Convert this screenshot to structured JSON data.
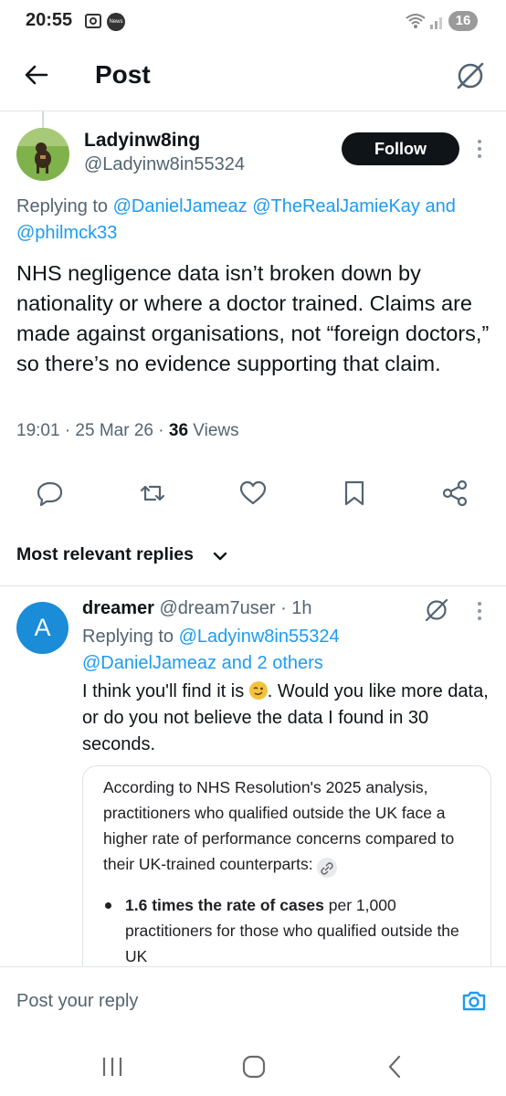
{
  "status_bar": {
    "time": "20:55",
    "battery": "16",
    "news_label": "News"
  },
  "header": {
    "title": "Post"
  },
  "post": {
    "author_name": "Ladyinw8ing",
    "author_handle": "@Ladyinw8in55324",
    "follow_label": "Follow",
    "replying_prefix": "Replying to ",
    "replying_to_1": "@DanielJameaz @TheRealJamieKay and",
    "replying_to_2": "@philmck33",
    "text": "NHS negligence data isn’t broken down by nationality or where a doctor trained. Claims are made against organisations, not “foreign doctors,” so there’s no evidence supporting that claim.",
    "timestamp": "19:01 · 25 Mar 26 · ",
    "views_count": "36",
    "views_label": " Views"
  },
  "sort_label": "Most relevant replies",
  "reply": {
    "avatar_letter": "A",
    "name": "dreamer",
    "handle_time": " @dream7user · 1h",
    "replying_prefix": "Replying to ",
    "replying_to_1": "@Ladyinw8in55324",
    "replying_to_2": "@DanielJameaz and 2 others",
    "text_before_emoji": "I think you'll find it is ",
    "text_after_emoji": ". Would you like more data, or do you not believe the data I found in 30 seconds."
  },
  "card": {
    "text": "According to NHS Resolution's 2025 analysis, practitioners who qualified outside the UK face a higher rate of performance concerns compared to their UK-trained counterparts: ",
    "bullet_bold": "1.6 times the rate of cases",
    "bullet_rest": " per 1,000 practitioners for those who qualified outside the UK"
  },
  "reply_bar": {
    "placeholder": "Post your reply"
  },
  "colors": {
    "link": "#1d9bf0",
    "secondary_text": "#536471",
    "primary_text": "#0f1419",
    "avatar_reply": "#1a8cd8"
  }
}
